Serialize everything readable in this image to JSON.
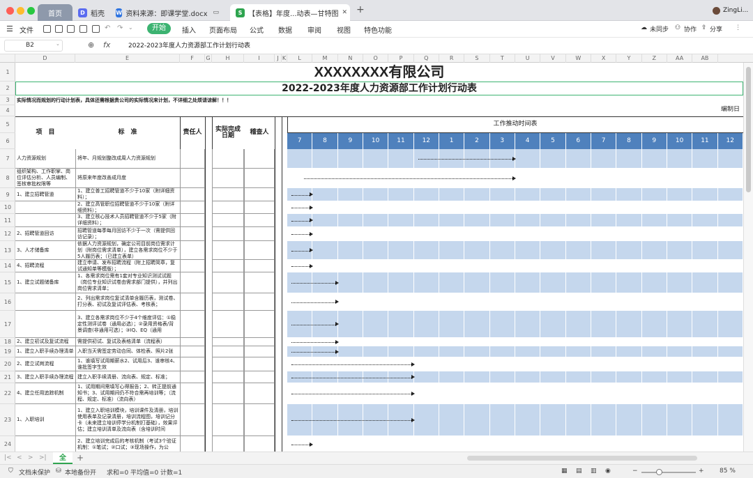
{
  "window": {
    "tabs": [
      {
        "label": "首页"
      },
      {
        "label": "稻壳"
      },
      {
        "label": "资料来源：即课学堂.docx"
      },
      {
        "label": "【表格】年度...动表—甘特图"
      }
    ],
    "new_tab": "+",
    "user": "ZingLi..."
  },
  "menu": {
    "file": "文件",
    "items": [
      "开始",
      "插入",
      "页面布局",
      "公式",
      "数据",
      "审阅",
      "视图",
      "特色功能"
    ],
    "active": "开始",
    "right": [
      "未同步",
      "协作",
      "分享"
    ]
  },
  "formula": {
    "cell_ref": "B2",
    "fx": "fx",
    "content": "2022-2023年度人力资源部工作计划行动表"
  },
  "columns": [
    "D",
    "E",
    "F",
    "G",
    "H",
    "I",
    "J",
    "K",
    "L",
    "M",
    "N",
    "O",
    "P",
    "Q",
    "R",
    "S",
    "T",
    "U",
    "V",
    "W",
    "X",
    "Y",
    "Z",
    "AA",
    "AB"
  ],
  "rows": [
    "1",
    "2",
    "3",
    "4",
    "5",
    "6",
    "7",
    "8",
    "9",
    "10",
    "11",
    "12",
    "13",
    "14",
    "15",
    "16",
    "17",
    "18",
    "19",
    "20",
    "21",
    "22",
    "23",
    "24"
  ],
  "sheet": {
    "company": "XXXXXXXX有限公司",
    "title": "2022-2023年度人力资源部工作计划行动表",
    "note": "实际情况而规划的行动计划表，具体还需根据贵公司的实际情况来计划，不详细之处烦请谅解！！！",
    "compile_date": "编制日",
    "headers": {
      "item": "项　目",
      "standard": "标　准",
      "owner": "责任人",
      "actual_date": "实际完成日期",
      "checker": "稽查人",
      "timeline": "工作推动时间表"
    },
    "months": [
      "7",
      "8",
      "9",
      "10",
      "11",
      "12",
      "1",
      "2",
      "3",
      "4",
      "5",
      "6",
      "7",
      "8",
      "9",
      "10",
      "11",
      "12"
    ],
    "tasks": [
      {
        "item": "人力资源规划",
        "standard": "将年、月规划整改成周人力资源规划"
      },
      {
        "item": "组织架构、工作职掌、岗位评估分析、人员编制、签核审批权限等",
        "standard": "将原来年度改善成月度"
      },
      {
        "item": "1、建立招聘管道",
        "standard": "1、建立普工招聘管道不少于10家（附详细资料）；"
      },
      {
        "item": "",
        "standard": "2、建立高管职位招聘管道不少于10家（附详细资料）；"
      },
      {
        "item": "",
        "standard": "3、建立核心技术人员招聘管道不少于5家（附详细资料）；"
      },
      {
        "item": "2、招聘管道回访",
        "standard": "招聘管道每季每月回访不少于一次（需提供回访记录）；"
      },
      {
        "item": "3、人才储备库",
        "standard": "依据人力资源规划，确定公司目前岗位需求计划（附岗位需求清单），建立各需求岗位不少于5人履历表；（已建立表单）"
      },
      {
        "item": "4、招聘流程",
        "standard": "建立申请、发布招聘流程（附上招聘简章，复试通知单等模版）；"
      },
      {
        "item": "1、建立试题储备库",
        "standard": "1、各需求岗位需有1套对专业知识测试试题（岗位专业知识试卷由需求部门提供），并列出岗位需求清单；"
      },
      {
        "item": "",
        "standard": "2、列出需求岗位复试清单含履历表，测试卷、打分表、初试及复试评估表、考核表；"
      },
      {
        "item": "",
        "standard": "3、建立各需求岗位不少于4个维度评估：①稳定性测评试卷（通用必选）；②录用资格表/背景调查(非通用可选）；③IQ、EQ（通用"
      },
      {
        "item": "2、建立初试及复试流程",
        "standard": "需提供初试、复试及表格清单（流程表）"
      },
      {
        "item": "1、建立入职手续办理清单",
        "standard": "入职当天需签定劳动合同、体检表、照片2张"
      },
      {
        "item": "2、建立试崗流程",
        "standard": "1、谁填写试用期薪水2、试用后3、谁审核4、谁批签字生效"
      },
      {
        "item": "3、建立入职手续办理流程",
        "standard": "建立入职手续清册、流向表、规定、标准；"
      },
      {
        "item": "4、建立任用追踪机制",
        "standard": "1、试用期间需填写心得报告；2、转正提前通知书；3、试用期间仍不符合需再培训等；（流程、规定、标准）（流向表）"
      },
      {
        "item": "1、入职培训",
        "standard": "1、建立入职培训模块，培训课件及清册，培训使用表单及记录清册，培训流程图，培训记分卡（未来建立培训停学分机制打基础），效果评估；建立培训清单及流向表（含培训时间"
      },
      {
        "item": "",
        "standard": "2、建立培训完成后的考核机制（考试3个验证机制：①笔试；②口试；③现场操作，为公"
      }
    ]
  },
  "sheet_tab": "全",
  "status": {
    "protect": "文档未保护",
    "backup": "本地备份开",
    "sum": "求和=0",
    "avg": "平均值=0",
    "count": "计数=1",
    "zoom": "85 %"
  },
  "gantt": [
    {
      "start": 5,
      "end": 9
    },
    {
      "start": 0.5,
      "end": 9
    },
    {
      "start": 0,
      "end": 1
    },
    {
      "start": 0,
      "end": 1
    },
    {
      "start": 0,
      "end": 1
    },
    {
      "start": 0,
      "end": 1
    },
    {
      "start": 0,
      "end": 1
    },
    {
      "start": 0,
      "end": 1
    },
    {
      "start": 0,
      "end": 2
    },
    {
      "start": 0,
      "end": 2
    },
    {
      "start": 0,
      "end": 2
    },
    {
      "start": 0,
      "end": 2
    },
    {
      "start": 0,
      "end": 2
    },
    {
      "start": 0,
      "end": 5
    },
    {
      "start": 0,
      "end": 5
    },
    {
      "start": 0,
      "end": 5
    },
    {
      "start": 0,
      "end": 5
    },
    {
      "start": 0,
      "end": 1
    }
  ],
  "colors": {
    "accent_green": "#3cb371",
    "gantt_blue": "#4f81bd",
    "gantt_light": "#c5d7ed"
  }
}
